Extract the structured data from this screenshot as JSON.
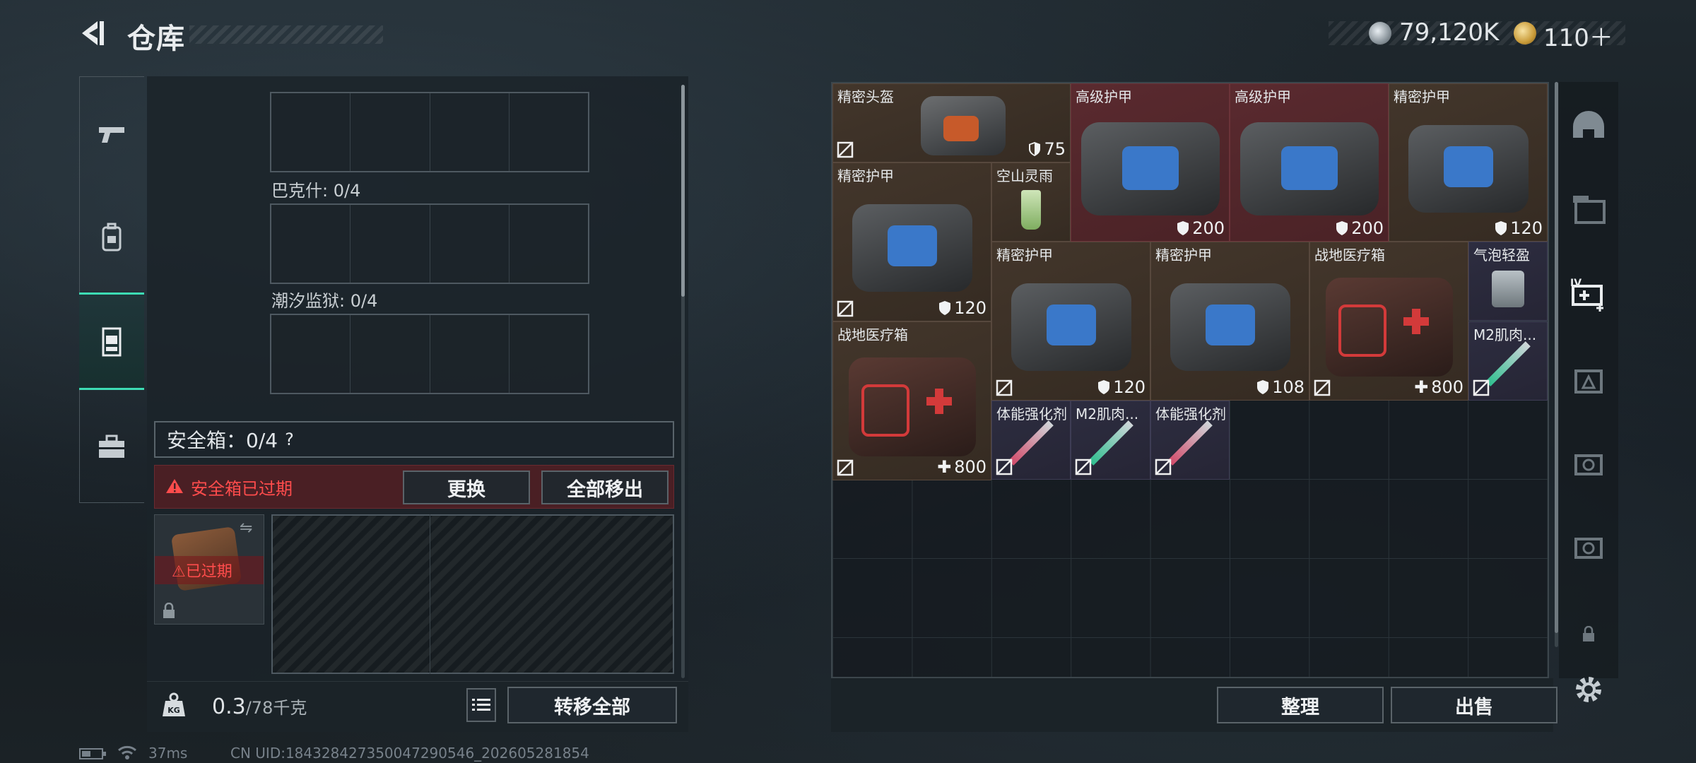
{
  "header": {
    "title": "仓库",
    "currency1": "79,120K",
    "currency2": "110＋"
  },
  "left": {
    "tabs": [
      "weapon-icon",
      "backpack-icon",
      "armor-vest-icon",
      "toolbox-icon"
    ],
    "slots": [
      {
        "label": "巴克什: 0/4"
      },
      {
        "label": "潮汐监狱: 0/4"
      }
    ],
    "safe_label": "安全箱：0/4",
    "safe_help": "?",
    "expired_notice": "安全箱已过期",
    "replace_button": "更换",
    "remove_all_button": "全部移出",
    "case_expired": "已过期",
    "weight_value": "0.3",
    "weight_max": "/78千克",
    "transfer_all_button": "转移全部"
  },
  "inventory": {
    "items": [
      {
        "name": "精密头盔",
        "value": "75",
        "icon": "shield"
      },
      {
        "name": "高级护甲",
        "value": "200",
        "icon": "shield"
      },
      {
        "name": "高级护甲",
        "value": "200",
        "icon": "shield"
      },
      {
        "name": "精密护甲",
        "value": "120",
        "icon": "shield"
      },
      {
        "name": "精密护甲",
        "value": "120",
        "icon": "shield"
      },
      {
        "name": "空山灵雨",
        "value": "",
        "icon": ""
      },
      {
        "name": "精密护甲",
        "value": "120",
        "icon": "shield"
      },
      {
        "name": "精密护甲",
        "value": "108",
        "icon": "shield"
      },
      {
        "name": "战地医疗箱",
        "value": "800",
        "icon": "plus"
      },
      {
        "name": "气泡轻盈",
        "value": "",
        "icon": ""
      },
      {
        "name": "战地医疗箱",
        "value": "800",
        "icon": "plus"
      },
      {
        "name": "M2肌肉...",
        "value": "",
        "icon": ""
      },
      {
        "name": "体能强化剂",
        "value": "",
        "icon": ""
      },
      {
        "name": "M2肌肉...",
        "value": "",
        "icon": ""
      },
      {
        "name": "体能强化剂",
        "value": "",
        "icon": ""
      }
    ],
    "sort_button": "整理",
    "sell_button": "出售"
  },
  "status": {
    "ping": "37ms",
    "uid": "CN UID:1843284273500472905​46_202605281854"
  },
  "colors": {
    "accent": "#3ddcb4",
    "danger": "#ff4c4c",
    "brown_item": "#43362b",
    "red_item": "#5a2a2f",
    "purple_item": "#2d2d40"
  }
}
